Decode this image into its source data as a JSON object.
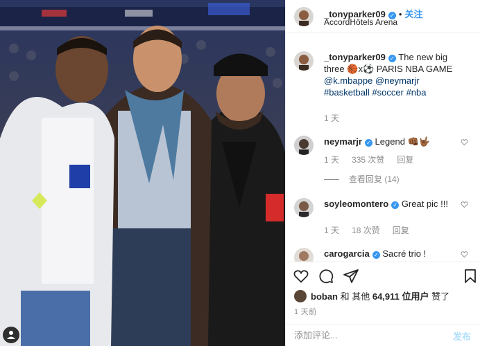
{
  "post": {
    "username": "_tonyparker09",
    "location": "AccordHôtels Arena",
    "follow_label": "关注",
    "dot": "•",
    "verified_glyph": "✓"
  },
  "caption": {
    "username": "_tonyparker09",
    "text_1": "The new big three ",
    "emoji_1": "🏀",
    "x": "x",
    "emoji_2": "⚽",
    "text_2": " PARIS NBA GAME ",
    "mention_1": "@k.mbappe",
    "mention_2": "@neymarjr",
    "hashtag_1": "#basketball",
    "hashtag_2": "#soccer",
    "hashtag_3": "#nba",
    "time": "1 天"
  },
  "comments": [
    {
      "username": "neymarjr",
      "text": "Legend 👊🏾🤟🏾",
      "time": "1 天",
      "likes": "335 次赞",
      "reply_label": "回复",
      "view_replies": "查看回复 (14)"
    },
    {
      "username": "soyleomontero",
      "text": "Great pic !!!",
      "time": "1 天",
      "likes": "18 次赞",
      "reply_label": "回复"
    },
    {
      "username": "carogarcia",
      "text": "Sacré trio !"
    }
  ],
  "likes_line": {
    "first_liker": "boban",
    "and_others": " 和 其他 ",
    "count": "64,911 位用户",
    "suffix": " 赞了"
  },
  "timestamp": "1 天前",
  "add_comment": {
    "placeholder": "添加评论...",
    "post_label": "发布"
  },
  "icons": [
    "heart-icon",
    "comment-icon",
    "share-icon",
    "bookmark-icon",
    "verified-icon",
    "user-tag-icon"
  ],
  "colors": {
    "link": "#003569",
    "verified": "#3897f0",
    "meta": "#8e8e8e",
    "post_disabled": "#b2dffc"
  }
}
